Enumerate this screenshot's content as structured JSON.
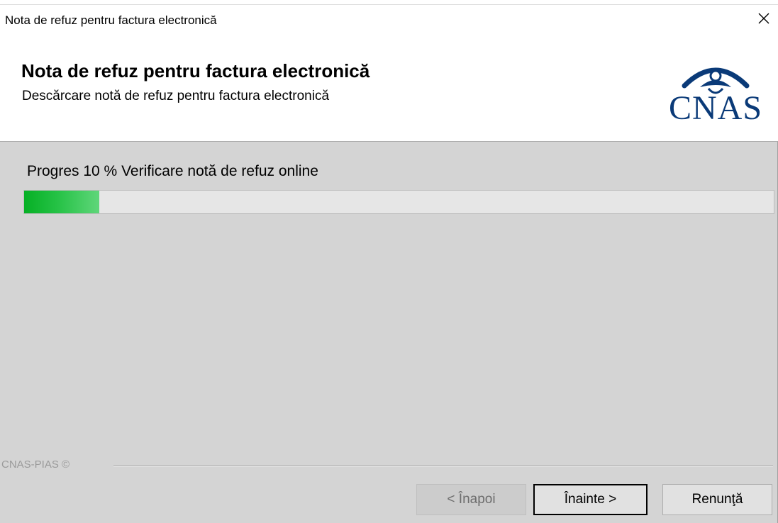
{
  "window": {
    "title": "Nota de refuz pentru factura electronică"
  },
  "header": {
    "title": "Nota de refuz pentru factura electronică",
    "subtitle": "Descărcare notă de refuz pentru factura electronică",
    "logo_text": "CNAS",
    "logo_color": "#0a3a78"
  },
  "progress": {
    "label": "Progres 10 % Verificare notă de refuz online",
    "percent": 10,
    "fill_color": "#06b025"
  },
  "footer": {
    "brand": "CNAS-PIAS ©"
  },
  "buttons": {
    "back_label": "< Înapoi",
    "next_label": "Înainte >",
    "cancel_label": "Renunţă"
  }
}
